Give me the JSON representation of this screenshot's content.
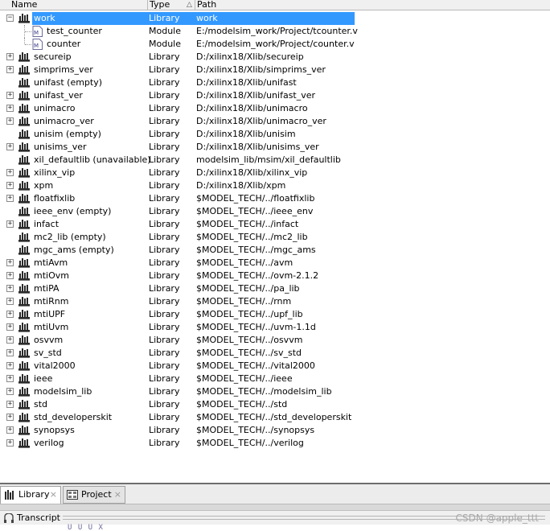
{
  "columns": {
    "name": "Name",
    "type": "Type",
    "path": "Path"
  },
  "rows": [
    {
      "name": "work",
      "type": "Library",
      "path": "work",
      "expander": "−",
      "selected": true
    },
    {
      "name": "test_counter",
      "type": "Module",
      "path": "E:/modelsim_work/Project/tcounter.v",
      "child": true
    },
    {
      "name": "counter",
      "type": "Module",
      "path": "E:/modelsim_work/Project/counter.v",
      "child": true
    },
    {
      "name": "secureip",
      "type": "Library",
      "path": "D:/xilinx18/Xlib/secureip",
      "expander": "+"
    },
    {
      "name": "simprims_ver",
      "type": "Library",
      "path": "D:/xilinx18/Xlib/simprims_ver",
      "expander": "+"
    },
    {
      "name": "unifast  (empty)",
      "type": "Library",
      "path": "D:/xilinx18/Xlib/unifast",
      "expander": ""
    },
    {
      "name": "unifast_ver",
      "type": "Library",
      "path": "D:/xilinx18/Xlib/unifast_ver",
      "expander": "+"
    },
    {
      "name": "unimacro",
      "type": "Library",
      "path": "D:/xilinx18/Xlib/unimacro",
      "expander": "+"
    },
    {
      "name": "unimacro_ver",
      "type": "Library",
      "path": "D:/xilinx18/Xlib/unimacro_ver",
      "expander": "+"
    },
    {
      "name": "unisim  (empty)",
      "type": "Library",
      "path": "D:/xilinx18/Xlib/unisim",
      "expander": ""
    },
    {
      "name": "unisims_ver",
      "type": "Library",
      "path": "D:/xilinx18/Xlib/unisims_ver",
      "expander": "+"
    },
    {
      "name": "xil_defaultlib  (unavailable)",
      "type": "Library",
      "path": "modelsim_lib/msim/xil_defaultlib",
      "expander": ""
    },
    {
      "name": "xilinx_vip",
      "type": "Library",
      "path": "D:/xilinx18/Xlib/xilinx_vip",
      "expander": "+"
    },
    {
      "name": "xpm",
      "type": "Library",
      "path": "D:/xilinx18/Xlib/xpm",
      "expander": "+"
    },
    {
      "name": "floatfixlib",
      "type": "Library",
      "path": "$MODEL_TECH/../floatfixlib",
      "expander": "+"
    },
    {
      "name": "ieee_env  (empty)",
      "type": "Library",
      "path": "$MODEL_TECH/../ieee_env",
      "expander": ""
    },
    {
      "name": "infact",
      "type": "Library",
      "path": "$MODEL_TECH/../infact",
      "expander": "+"
    },
    {
      "name": "mc2_lib  (empty)",
      "type": "Library",
      "path": "$MODEL_TECH/../mc2_lib",
      "expander": ""
    },
    {
      "name": "mgc_ams  (empty)",
      "type": "Library",
      "path": "$MODEL_TECH/../mgc_ams",
      "expander": ""
    },
    {
      "name": "mtiAvm",
      "type": "Library",
      "path": "$MODEL_TECH/../avm",
      "expander": "+"
    },
    {
      "name": "mtiOvm",
      "type": "Library",
      "path": "$MODEL_TECH/../ovm-2.1.2",
      "expander": "+"
    },
    {
      "name": "mtiPA",
      "type": "Library",
      "path": "$MODEL_TECH/../pa_lib",
      "expander": "+"
    },
    {
      "name": "mtiRnm",
      "type": "Library",
      "path": "$MODEL_TECH/../rnm",
      "expander": "+"
    },
    {
      "name": "mtiUPF",
      "type": "Library",
      "path": "$MODEL_TECH/../upf_lib",
      "expander": "+"
    },
    {
      "name": "mtiUvm",
      "type": "Library",
      "path": "$MODEL_TECH/../uvm-1.1d",
      "expander": "+"
    },
    {
      "name": "osvvm",
      "type": "Library",
      "path": "$MODEL_TECH/../osvvm",
      "expander": "+"
    },
    {
      "name": "sv_std",
      "type": "Library",
      "path": "$MODEL_TECH/../sv_std",
      "expander": "+"
    },
    {
      "name": "vital2000",
      "type": "Library",
      "path": "$MODEL_TECH/../vital2000",
      "expander": "+"
    },
    {
      "name": "ieee",
      "type": "Library",
      "path": "$MODEL_TECH/../ieee",
      "expander": "+"
    },
    {
      "name": "modelsim_lib",
      "type": "Library",
      "path": "$MODEL_TECH/../modelsim_lib",
      "expander": "+"
    },
    {
      "name": "std",
      "type": "Library",
      "path": "$MODEL_TECH/../std",
      "expander": "+"
    },
    {
      "name": "std_developerskit",
      "type": "Library",
      "path": "$MODEL_TECH/../std_developerskit",
      "expander": "+"
    },
    {
      "name": "synopsys",
      "type": "Library",
      "path": "$MODEL_TECH/../synopsys",
      "expander": "+"
    },
    {
      "name": "verilog",
      "type": "Library",
      "path": "$MODEL_TECH/../verilog",
      "expander": "+"
    }
  ],
  "tabs": [
    {
      "label": "Library",
      "icon": "library-icon",
      "close": "×"
    },
    {
      "label": "Project",
      "icon": "project-icon",
      "close": "×"
    }
  ],
  "transcript": {
    "label": "Transcript"
  },
  "watermark": "CSDN @apple_ttt",
  "bottom_glyphs": "U U U   X",
  "colors": {
    "selection": "#3399ff",
    "library_icon": "#2a2a2a"
  }
}
